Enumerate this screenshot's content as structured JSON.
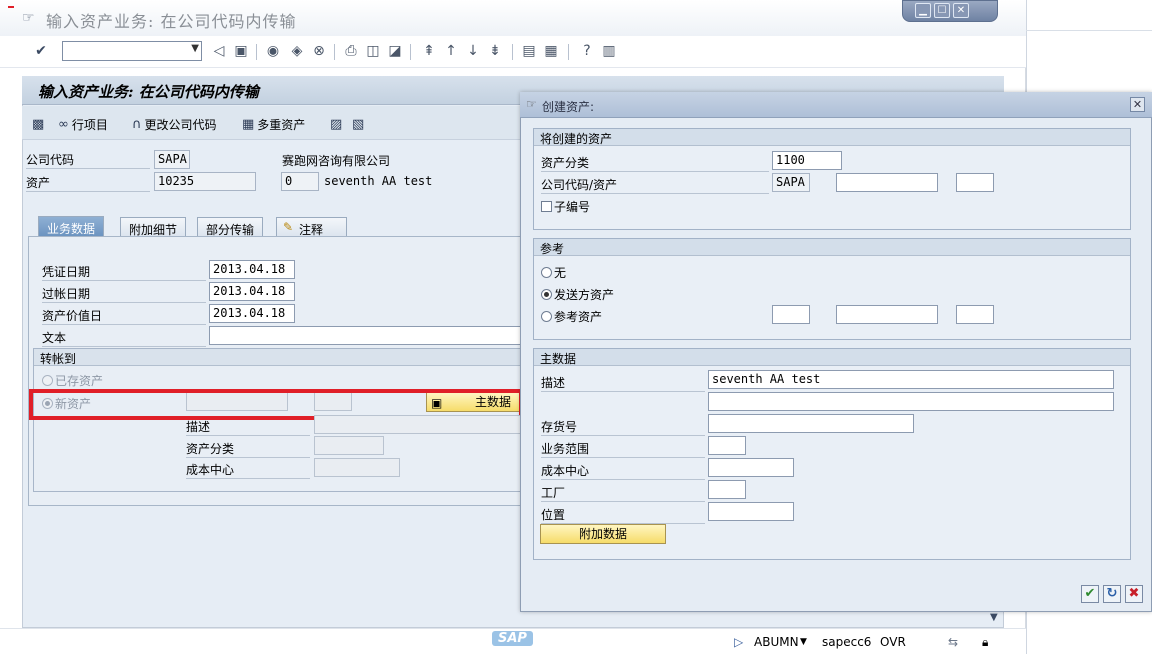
{
  "window": {
    "title": "输入资产业务: 在公司代码内传输",
    "controls": {
      "minimize": "▁",
      "maximize": "☐",
      "close": "✕"
    }
  },
  "toolbar": {
    "command_value": ""
  },
  "panel": {
    "title": "输入资产业务: 在公司代码内传输",
    "buttons": {
      "line_items": "行项目",
      "change_company_code": "更改公司代码",
      "multiple_assets": "多重资产"
    }
  },
  "header": {
    "company_code_label": "公司代码",
    "company_code_value": "SAPA",
    "company_name": "赛跑网咨询有限公司",
    "asset_label": "资产",
    "asset_value": "10235",
    "sub_number_value": "0",
    "asset_description": "seventh AA test"
  },
  "tabs": [
    {
      "label": "业务数据",
      "active": true
    },
    {
      "label": "附加细节",
      "active": false
    },
    {
      "label": "部分传输",
      "active": false
    },
    {
      "label": "注释",
      "active": false
    }
  ],
  "business_data": {
    "document_date_label": "凭证日期",
    "document_date": "2013.04.18",
    "posting_date_label": "过帐日期",
    "posting_date": "2013.04.18",
    "value_date_label": "资产价值日",
    "value_date": "2013.04.18",
    "text_label": "文本",
    "transfer_group_label": "转帐到",
    "existing_asset_label": "已存资产",
    "new_asset_label": "新资产",
    "master_data_button": "主数据",
    "description_label": "描述",
    "asset_class_label": "资产分类",
    "cost_center_label": "成本中心"
  },
  "dialog": {
    "title": "创建资产:",
    "asset_group_label": "将创建的资产",
    "asset_class_label": "资产分类",
    "asset_class_value": "1100",
    "company_code_label": "公司代码/资产",
    "company_code_value": "SAPA",
    "sub_number_label": "子编号",
    "reference_group_label": "参考",
    "ref_none_label": "无",
    "ref_sending_label": "发送方资产",
    "ref_asset_label": "参考资产",
    "master_group_label": "主数据",
    "description_label": "描述",
    "description_value": "seventh AA test",
    "inventory_label": "存货号",
    "business_area_label": "业务范围",
    "cost_center_label": "成本中心",
    "plant_label": "工厂",
    "location_label": "位置",
    "additional_data_button": "附加数据"
  },
  "status_bar": {
    "transaction": "ABUMN",
    "system": "sapecc6",
    "mode": "OVR",
    "logo": "SAP"
  },
  "colors": {
    "highlight": "#e01f28",
    "active_tab": "#6a92bf",
    "yellow_button": "#f6dc6a"
  }
}
